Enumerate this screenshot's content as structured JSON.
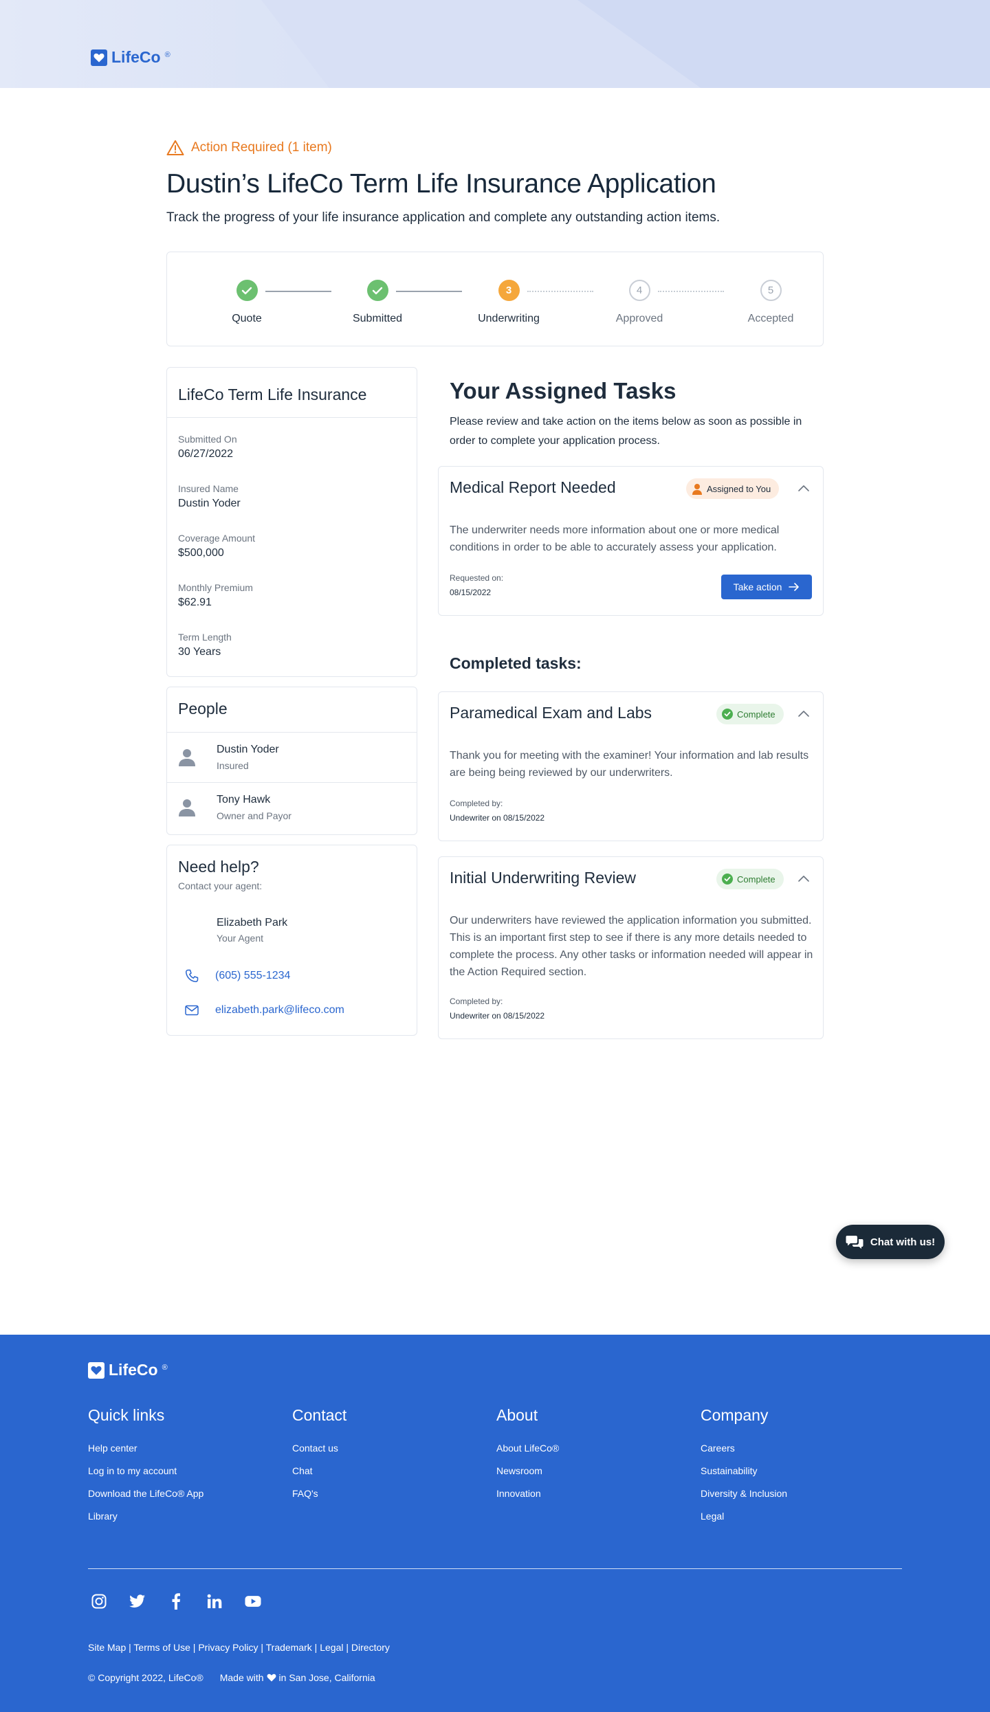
{
  "brand": {
    "name": "LifeCo",
    "mark": "®",
    "color": "#2a66cf"
  },
  "alert": {
    "text": "Action Required (1 item)",
    "color": "#e8791f"
  },
  "page": {
    "title": "Dustin’s LifeCo Term Life Insurance Application",
    "subtitle": "Track the progress of your life insurance application and complete any outstanding action items."
  },
  "progress": {
    "steps": [
      {
        "label": "Quote",
        "state": "done"
      },
      {
        "label": "Submitted",
        "state": "done"
      },
      {
        "number": "3",
        "label": "Underwriting",
        "state": "current"
      },
      {
        "number": "4",
        "label": "Approved",
        "state": "future"
      },
      {
        "number": "5",
        "label": "Accepted",
        "state": "future"
      }
    ]
  },
  "policy": {
    "title": "LifeCo Term Life Insurance",
    "fields": [
      {
        "label": "Submitted On",
        "value": "06/27/2022"
      },
      {
        "label": "Insured Name",
        "value": "Dustin Yoder"
      },
      {
        "label": "Coverage Amount",
        "value": "$500,000"
      },
      {
        "label": "Monthly Premium",
        "value": "$62.91"
      },
      {
        "label": "Term Length",
        "value": "30 Years"
      }
    ]
  },
  "people": {
    "title": "People",
    "list": [
      {
        "name": "Dustin Yoder",
        "role": "Insured"
      },
      {
        "name": "Tony Hawk",
        "role": "Owner and Payor"
      }
    ]
  },
  "help": {
    "title": "Need help?",
    "subtitle": "Contact your agent:",
    "agent_name": "Elizabeth Park",
    "agent_role": "Your Agent",
    "phone": "(605) 555-1234",
    "email": "elizabeth.park@lifeco.com"
  },
  "tasks": {
    "title": "Your Assigned Tasks",
    "intro": "Please review and take action on the items below as soon as possible in order to complete your application process.",
    "assigned": [
      {
        "title": "Medical Report Needed",
        "badge": "Assigned to You",
        "body": "The underwriter needs more information about one or more medical conditions in order to be able to accurately assess your application.",
        "meta_label": "Requested on:",
        "meta_value": "08/15/2022",
        "action_label": "Take action"
      }
    ],
    "completed_heading": "Completed tasks:",
    "completed": [
      {
        "title": "Paramedical Exam and Labs",
        "badge": "Complete",
        "body": "Thank you for meeting with the examiner!  Your information and lab results are being being reviewed by our underwriters.",
        "meta_label": "Completed by:",
        "meta_value": "Undewriter on 08/15/2022"
      },
      {
        "title": "Initial Underwriting Review",
        "badge": "Complete",
        "body": "Our underwriters have reviewed the application information you submitted.  This is an important first step to see if there is any more details needed to complete the process.  Any other tasks or information needed will appear in the Action Required section.",
        "meta_label": "Completed by:",
        "meta_value": "Undewriter on 08/15/2022"
      }
    ]
  },
  "chat": {
    "label": "Chat with us!"
  },
  "footer": {
    "columns": [
      {
        "heading": "Quick links",
        "links": [
          "Help center",
          "Log in to my account",
          "Download the LifeCo® App",
          "Library"
        ]
      },
      {
        "heading": "Contact",
        "links": [
          "Contact us",
          "Chat",
          "FAQ's"
        ]
      },
      {
        "heading": "About",
        "links": [
          "About LifeCo®",
          "Newsroom",
          "Innovation"
        ]
      },
      {
        "heading": "Company",
        "links": [
          "Careers",
          "Sustainability",
          "Diversity & Inclusion",
          "Legal"
        ]
      }
    ],
    "socials": [
      "instagram-icon",
      "twitter-icon",
      "facebook-icon",
      "linkedin-icon",
      "youtube-icon"
    ],
    "legal_links": [
      "Site Map",
      "Terms of Use",
      "Privacy Policy",
      "Trademark",
      "Legal",
      "Directory"
    ],
    "copyright": "© Copyright 2022, LifeCo®",
    "made_prefix": "Made with",
    "made_suffix": "in San Jose, California"
  }
}
